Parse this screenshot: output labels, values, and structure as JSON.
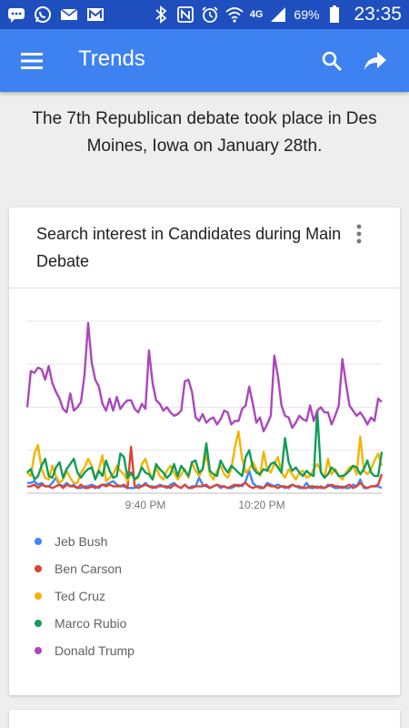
{
  "status_bar": {
    "network": "4G",
    "battery": "69%",
    "time": "23:35"
  },
  "app_bar": {
    "title": "Trends"
  },
  "headline": "The 7th Republican debate took place in Des Moines, Iowa on January 28th.",
  "card": {
    "title": "Search interest in Candidates during Main Debate"
  },
  "chart_data": {
    "type": "line",
    "x_ticks": [
      "9:40 PM",
      "10:20 PM"
    ],
    "ylim": [
      0,
      100
    ],
    "grid": true,
    "legend": "bottom",
    "series": [
      {
        "name": "Jeb Bush",
        "color": "#4285f4",
        "values": [
          6,
          6,
          7,
          5,
          6,
          4,
          4,
          6,
          9,
          5,
          4,
          6,
          4,
          5,
          3,
          3,
          4,
          4,
          5,
          4,
          3,
          5,
          5,
          6,
          7,
          5,
          4,
          4,
          3,
          3,
          3,
          5,
          4,
          6,
          4,
          4,
          3,
          5,
          4,
          3,
          5,
          6,
          4,
          3,
          5,
          3,
          4,
          4,
          9,
          5,
          4,
          3,
          4,
          5,
          3,
          4,
          3,
          3,
          4,
          5,
          4,
          7,
          13,
          6,
          4,
          4,
          3,
          6,
          5,
          4,
          5,
          4,
          3,
          4,
          5,
          4,
          3,
          3,
          6,
          3,
          3,
          4,
          3,
          3,
          5,
          4,
          3,
          3,
          4,
          3,
          3,
          5,
          4,
          8,
          3,
          3,
          4,
          4,
          4,
          3
        ]
      },
      {
        "name": "Ben Carson",
        "color": "#db4437",
        "values": [
          4,
          4,
          5,
          3,
          5,
          4,
          4,
          3,
          4,
          5,
          3,
          5,
          4,
          4,
          3,
          5,
          3,
          3,
          4,
          3,
          4,
          5,
          4,
          5,
          4,
          4,
          4,
          5,
          3,
          27,
          4,
          3,
          4,
          5,
          4,
          3,
          4,
          4,
          4,
          4,
          3,
          5,
          4,
          3,
          5,
          3,
          3,
          4,
          4,
          4,
          5,
          3,
          4,
          5,
          4,
          4,
          3,
          4,
          5,
          4,
          5,
          6,
          4,
          3,
          4,
          3,
          3,
          5,
          4,
          4,
          3,
          4,
          4,
          3,
          5,
          4,
          4,
          3,
          3,
          4,
          4,
          3,
          4,
          3,
          4,
          5,
          4,
          4,
          3,
          4,
          5,
          3,
          4,
          6,
          4,
          3,
          4,
          4,
          5,
          11
        ]
      },
      {
        "name": "Ted Cruz",
        "color": "#f4b400",
        "values": [
          12,
          10,
          23,
          28,
          14,
          9,
          8,
          16,
          10,
          6,
          8,
          13,
          9,
          6,
          6,
          12,
          15,
          20,
          16,
          8,
          14,
          22,
          7,
          9,
          11,
          16,
          13,
          11,
          7,
          12,
          8,
          9,
          17,
          20,
          13,
          8,
          15,
          10,
          8,
          13,
          16,
          12,
          8,
          11,
          14,
          9,
          18,
          13,
          10,
          14,
          23,
          11,
          8,
          13,
          16,
          11,
          9,
          14,
          27,
          36,
          20,
          12,
          14,
          18,
          14,
          10,
          24,
          14,
          12,
          17,
          21,
          12,
          9,
          14,
          11,
          8,
          12,
          13,
          9,
          10,
          14,
          17,
          13,
          9,
          20,
          11,
          14,
          10,
          8,
          12,
          15,
          16,
          11,
          33,
          13,
          11,
          14,
          19,
          23,
          16
        ]
      },
      {
        "name": "Marco Rubio",
        "color": "#0f9d58",
        "values": [
          12,
          14,
          8,
          10,
          16,
          20,
          10,
          9,
          15,
          18,
          9,
          14,
          17,
          20,
          12,
          9,
          12,
          14,
          15,
          8,
          13,
          10,
          19,
          13,
          9,
          10,
          23,
          21,
          9,
          12,
          8,
          10,
          15,
          12,
          11,
          8,
          17,
          14,
          12,
          9,
          11,
          17,
          10,
          16,
          13,
          10,
          18,
          19,
          12,
          14,
          29,
          13,
          11,
          10,
          19,
          15,
          12,
          16,
          14,
          12,
          10,
          21,
          25,
          15,
          12,
          11,
          14,
          13,
          17,
          18,
          15,
          12,
          32,
          18,
          13,
          15,
          12,
          10,
          13,
          11,
          10,
          48,
          12,
          9,
          11,
          15,
          13,
          10,
          10,
          11,
          13,
          16,
          15,
          11,
          14,
          19,
          12,
          10,
          10,
          24
        ]
      },
      {
        "name": "Donald Trump",
        "color": "#ab47bc",
        "values": [
          50,
          71,
          70,
          73,
          72,
          66,
          74,
          64,
          59,
          55,
          49,
          47,
          58,
          48,
          50,
          53,
          69,
          99,
          76,
          66,
          62,
          52,
          48,
          55,
          48,
          56,
          49,
          52,
          54,
          54,
          49,
          47,
          52,
          49,
          83,
          64,
          54,
          52,
          48,
          50,
          47,
          45,
          46,
          48,
          65,
          66,
          59,
          44,
          42,
          46,
          41,
          43,
          44,
          40,
          43,
          48,
          47,
          40,
          42,
          42,
          49,
          51,
          62,
          52,
          41,
          44,
          36,
          40,
          45,
          80,
          68,
          51,
          45,
          44,
          38,
          41,
          45,
          43,
          42,
          51,
          42,
          48,
          50,
          47,
          47,
          40,
          45,
          51,
          78,
          64,
          51,
          48,
          45,
          47,
          44,
          40,
          44,
          42,
          55,
          53
        ]
      }
    ]
  }
}
